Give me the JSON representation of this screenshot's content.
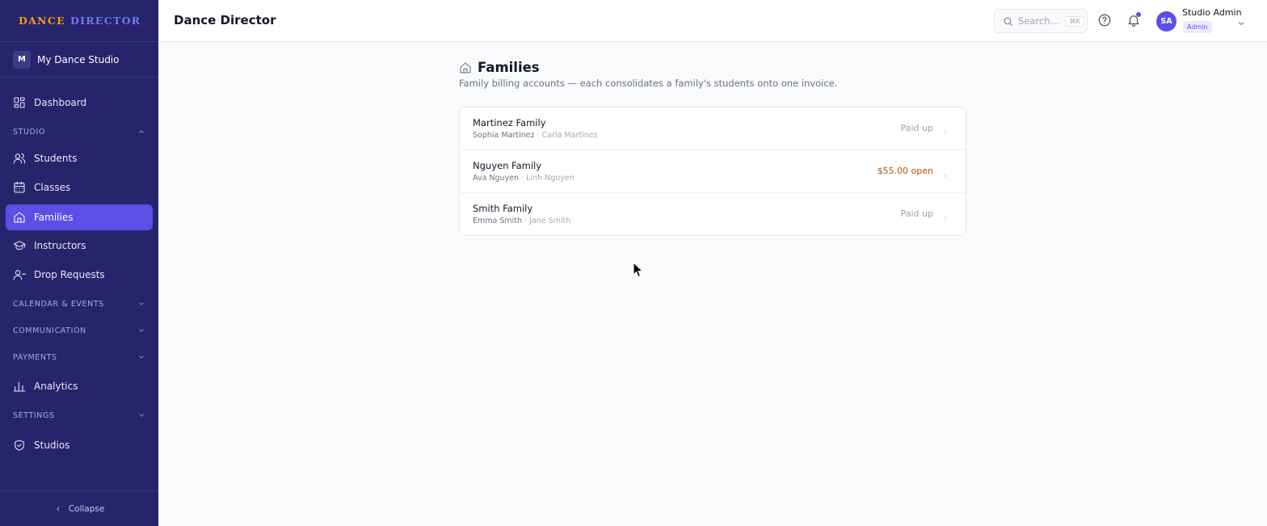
{
  "brand": {
    "part1": "DANCE",
    "part2": "DIRECTOR"
  },
  "studio": {
    "initial": "M",
    "name": "My Dance Studio"
  },
  "sidebar": {
    "dashboard": "Dashboard",
    "section_studio": "STUDIO",
    "students": "Students",
    "classes": "Classes",
    "families": "Families",
    "instructors": "Instructors",
    "drop_requests": "Drop Requests",
    "section_calendar": "CALENDAR & EVENTS",
    "section_communication": "COMMUNICATION",
    "section_payments": "PAYMENTS",
    "analytics": "Analytics",
    "section_settings": "SETTINGS",
    "studios": "Studios",
    "collapse": "Collapse",
    "active_item": "Families"
  },
  "header": {
    "title": "Dance Director",
    "search_placeholder": "Search...",
    "search_shortcut": "⌘K",
    "user_initials": "SA",
    "user_name": "Studio Admin",
    "user_role": "Admin"
  },
  "page": {
    "title": "Families",
    "subtitle": "Family billing accounts — each consolidates a family's students onto one invoice."
  },
  "families": [
    {
      "name": "Martinez Family",
      "student": "Sophia Martinez",
      "guardian": "Carla Martinez",
      "status": "Paid up"
    },
    {
      "name": "Nguyen Family",
      "student": "Ava Nguyen",
      "guardian": "Linh Nguyen",
      "status": "$55.00 open"
    },
    {
      "name": "Smith Family",
      "student": "Emma Smith",
      "guardian": "Jane Smith",
      "status": "Paid up"
    }
  ],
  "colors": {
    "sidebar_bg": "#27246b",
    "accent": "#5b4fe6",
    "brand_orange": "#f59e0b",
    "open_balance": "#b45309"
  },
  "icons": {
    "dashboard": "grid-icon",
    "students": "users-icon",
    "classes": "calendar-icon",
    "families": "home-icon",
    "instructors": "graduation-cap-icon",
    "drop_requests": "user-minus-icon",
    "analytics": "bar-chart-icon",
    "studios": "shield-check-icon"
  }
}
